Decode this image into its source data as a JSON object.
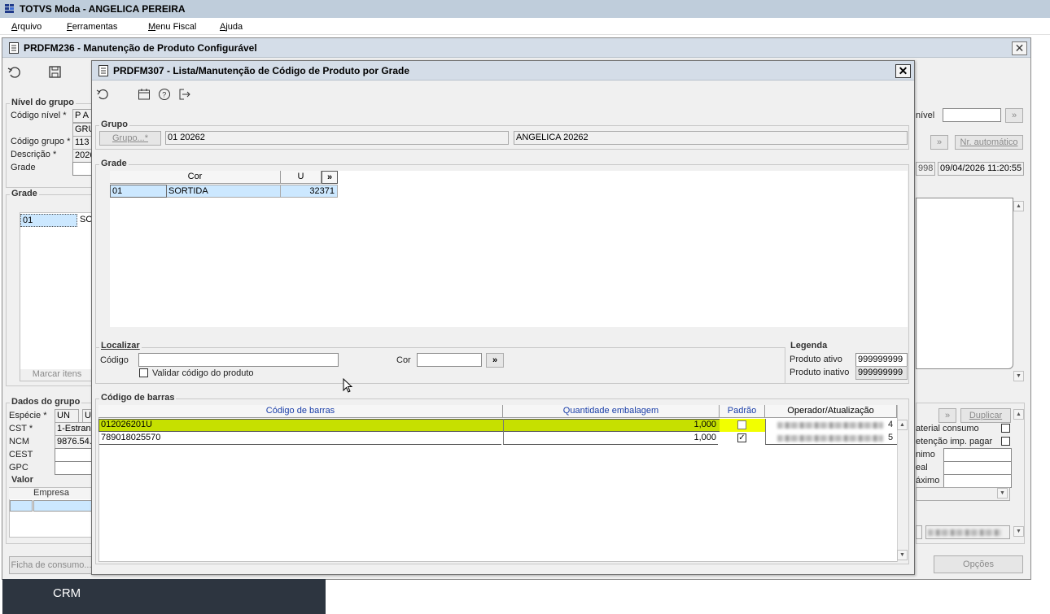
{
  "app": {
    "title": "TOTVS Moda - ANGELICA PEREIRA",
    "menu": [
      "Arquivo",
      "Ferramentas",
      "Menu Fiscal",
      "Ajuda"
    ]
  },
  "bg_window": {
    "title": "PRDFM236 - Manutenção de Produto Configurável",
    "nivel_group": {
      "label": "Nível do grupo",
      "codigo_nivel_label": "Código nível *",
      "codigo_nivel_value": "P A",
      "codigo_nivel_value2": "GRU",
      "codigo_grupo_label": "Código grupo *",
      "codigo_grupo_value": "113",
      "descricao_label": "Descrição *",
      "descricao_value": "2026",
      "grade_label": "Grade"
    },
    "grade_group": {
      "label": "Grade",
      "row_code": "01",
      "row_desc": "SO",
      "marcar_itens": "Marcar itens"
    },
    "dados_group": {
      "label": "Dados do grupo",
      "especie_label": "Espécie *",
      "especie_value": "UN",
      "especie_value2": "U",
      "cst_label": "CST *",
      "cst_value": "1-Estran",
      "ncm_label": "NCM",
      "ncm_value": "9876.54.",
      "cest_label": "CEST",
      "gpc_label": "GPC"
    },
    "valor_group": {
      "label": "Valor",
      "empresa_header": "Empresa"
    },
    "right_side": {
      "nivel_label": "nível",
      "nr_automatico": "Nr. automático",
      "code_partial": "998",
      "datetime": "09/04/2026 11:20:55",
      "duplicar": "Duplicar",
      "material_consumo": "aterial consumo",
      "retencao": "etenção imp. pagar",
      "minimo": "nimo",
      "real": "eal",
      "maximo": "áximo",
      "opcoes": "Opções"
    },
    "ficha_consumo": "Ficha de consumo..."
  },
  "dialog": {
    "title": "PRDFM307 - Lista/Manutenção de Código de Produto por Grade",
    "grupo": {
      "label": "Grupo",
      "button": "Grupo...*",
      "code": "01 20262",
      "name": "ANGELICA 20262"
    },
    "grade": {
      "label": "Grade",
      "headers": [
        "Cor",
        "U",
        "»"
      ],
      "rows": [
        {
          "code": "01",
          "cor": "SORTIDA",
          "u": "32371"
        }
      ]
    },
    "localizar": {
      "label": "Localizar",
      "codigo_label": "Código",
      "codigo_value": "",
      "cor_label": "Cor",
      "cor_value": "",
      "go": "»",
      "validar_label": "Validar código do produto",
      "validar_checked": false
    },
    "legenda": {
      "label": "Legenda",
      "ativo_label": "Produto ativo",
      "ativo_value": "999999999",
      "inativo_label": "Produto inativo",
      "inativo_value": "999999999"
    },
    "barcodes": {
      "label": "Código de barras",
      "headers": [
        "Código de barras",
        "Quantidade embalagem",
        "Padrão",
        "Operador/Atualização"
      ],
      "rows": [
        {
          "codigo": "012026201U",
          "qtd": "1,000",
          "padrao": false,
          "oper_suffix": "4",
          "highlight": true
        },
        {
          "codigo": "789018025570",
          "qtd": "1,000",
          "padrao": true,
          "oper_suffix": "5",
          "highlight": false
        }
      ]
    }
  },
  "crm": {
    "label": "CRM"
  },
  "colors": {
    "title_bar": "#bfcddb",
    "row_highlight": "#c6e000",
    "selected_cell": "#cce8ff",
    "header_blue_text": "#1a3ea8"
  }
}
